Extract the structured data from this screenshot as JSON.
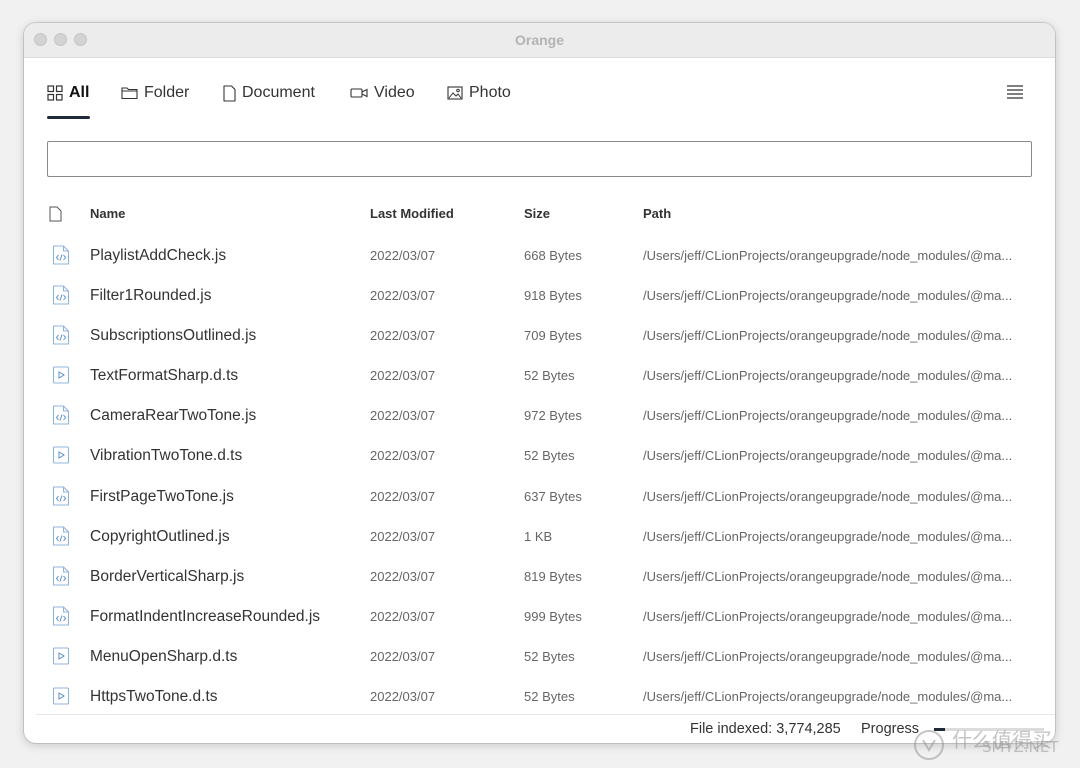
{
  "window": {
    "title": "Orange"
  },
  "tabs": [
    {
      "label": "All",
      "icon": "grid-icon",
      "active": true
    },
    {
      "label": "Folder",
      "icon": "folder-icon",
      "active": false
    },
    {
      "label": "Document",
      "icon": "document-icon",
      "active": false
    },
    {
      "label": "Video",
      "icon": "video-camera-icon",
      "active": false
    },
    {
      "label": "Photo",
      "icon": "image-icon",
      "active": false
    }
  ],
  "menu_icon": "hamburger-menu-icon",
  "search": {
    "value": "",
    "placeholder": ""
  },
  "table": {
    "columns": {
      "icon": "file-icon",
      "name": "Name",
      "modified": "Last Modified",
      "size": "Size",
      "path": "Path"
    },
    "rows": [
      {
        "icon": "js-file-icon",
        "name": "PlaylistAddCheck.js",
        "modified": "2022/03/07",
        "size": "668 Bytes",
        "path": "/Users/jeff/CLionProjects/orangeupgrade/node_modules/@ma..."
      },
      {
        "icon": "js-file-icon",
        "name": "Filter1Rounded.js",
        "modified": "2022/03/07",
        "size": "918 Bytes",
        "path": "/Users/jeff/CLionProjects/orangeupgrade/node_modules/@ma..."
      },
      {
        "icon": "js-file-icon",
        "name": "SubscriptionsOutlined.js",
        "modified": "2022/03/07",
        "size": "709 Bytes",
        "path": "/Users/jeff/CLionProjects/orangeupgrade/node_modules/@ma..."
      },
      {
        "icon": "ts-file-icon",
        "name": "TextFormatSharp.d.ts",
        "modified": "2022/03/07",
        "size": "52 Bytes",
        "path": "/Users/jeff/CLionProjects/orangeupgrade/node_modules/@ma..."
      },
      {
        "icon": "js-file-icon",
        "name": "CameraRearTwoTone.js",
        "modified": "2022/03/07",
        "size": "972 Bytes",
        "path": "/Users/jeff/CLionProjects/orangeupgrade/node_modules/@ma..."
      },
      {
        "icon": "ts-file-icon",
        "name": "VibrationTwoTone.d.ts",
        "modified": "2022/03/07",
        "size": "52 Bytes",
        "path": "/Users/jeff/CLionProjects/orangeupgrade/node_modules/@ma..."
      },
      {
        "icon": "js-file-icon",
        "name": "FirstPageTwoTone.js",
        "modified": "2022/03/07",
        "size": "637 Bytes",
        "path": "/Users/jeff/CLionProjects/orangeupgrade/node_modules/@ma..."
      },
      {
        "icon": "js-file-icon",
        "name": "CopyrightOutlined.js",
        "modified": "2022/03/07",
        "size": "1 KB",
        "path": "/Users/jeff/CLionProjects/orangeupgrade/node_modules/@ma..."
      },
      {
        "icon": "js-file-icon",
        "name": "BorderVerticalSharp.js",
        "modified": "2022/03/07",
        "size": "819 Bytes",
        "path": "/Users/jeff/CLionProjects/orangeupgrade/node_modules/@ma..."
      },
      {
        "icon": "js-file-icon",
        "name": "FormatIndentIncreaseRounded.js",
        "modified": "2022/03/07",
        "size": "999 Bytes",
        "path": "/Users/jeff/CLionProjects/orangeupgrade/node_modules/@ma..."
      },
      {
        "icon": "ts-file-icon",
        "name": "MenuOpenSharp.d.ts",
        "modified": "2022/03/07",
        "size": "52 Bytes",
        "path": "/Users/jeff/CLionProjects/orangeupgrade/node_modules/@ma..."
      },
      {
        "icon": "ts-file-icon",
        "name": "HttpsTwoTone.d.ts",
        "modified": "2022/03/07",
        "size": "52 Bytes",
        "path": "/Users/jeff/CLionProjects/orangeupgrade/node_modules/@ma..."
      }
    ]
  },
  "status": {
    "indexed": "File indexed: 3,774,285",
    "progress_label": "Progress",
    "progress": 0.1
  },
  "watermark": {
    "text_cn": "什么值得买",
    "text_en": "SMYZ.NET"
  },
  "colors": {
    "accent": "#1f2a3a",
    "file_icon_blue": "#5b8fc9"
  }
}
